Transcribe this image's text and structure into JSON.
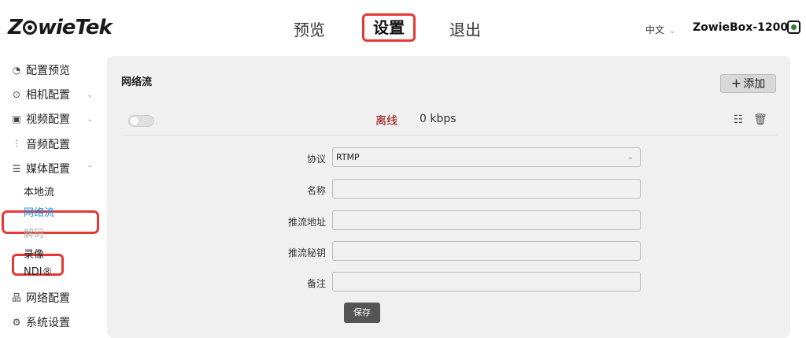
{
  "header": {
    "logo_text": "ZowieTek",
    "nav": {
      "preview": "预览",
      "settings": "设置",
      "logout": "退出"
    },
    "language": "中文",
    "device_name": "ZowieBox-12009",
    "icons": {
      "language_dropdown": "chevron-down-icon",
      "camera_status": "camera-icon"
    },
    "colors": {
      "highlight_box": "#e53935",
      "camera_status": "#2e7d32"
    }
  },
  "sidebar": {
    "items": [
      {
        "label": "配置预览",
        "icon": "gauge-icon"
      },
      {
        "label": "相机配置",
        "icon": "camera-icon"
      },
      {
        "label": "视频配置",
        "icon": "film-icon"
      },
      {
        "label": "音频配置",
        "icon": "equalizer-icon"
      },
      {
        "label": "媒体配置",
        "icon": "media-icon"
      },
      {
        "label": "网络配置",
        "icon": "network-icon"
      },
      {
        "label": "系统设置",
        "icon": "gear-icon"
      }
    ],
    "media_sub": [
      {
        "label": "本地流"
      },
      {
        "label": "网络流"
      },
      {
        "label": "解码"
      },
      {
        "label": "录像"
      },
      {
        "label": "NDI®"
      }
    ],
    "colors": {
      "active": "#1e88e5",
      "disabled": "#aaaaaa"
    }
  },
  "main": {
    "title": "网络流",
    "add_button": "添加",
    "stream": {
      "enabled": false,
      "status": "离线",
      "bitrate": "0 kbps",
      "status_color": "#8b0000"
    },
    "form": {
      "protocol_label": "协议",
      "protocol_value": "RTMP",
      "name_label": "名称",
      "name_value": "",
      "push_url_label": "推流地址",
      "push_url_value": "",
      "stream_key_label": "推流秘钥",
      "stream_key_value": "",
      "note_label": "备注",
      "note_value": "",
      "save_button": "保存"
    }
  }
}
